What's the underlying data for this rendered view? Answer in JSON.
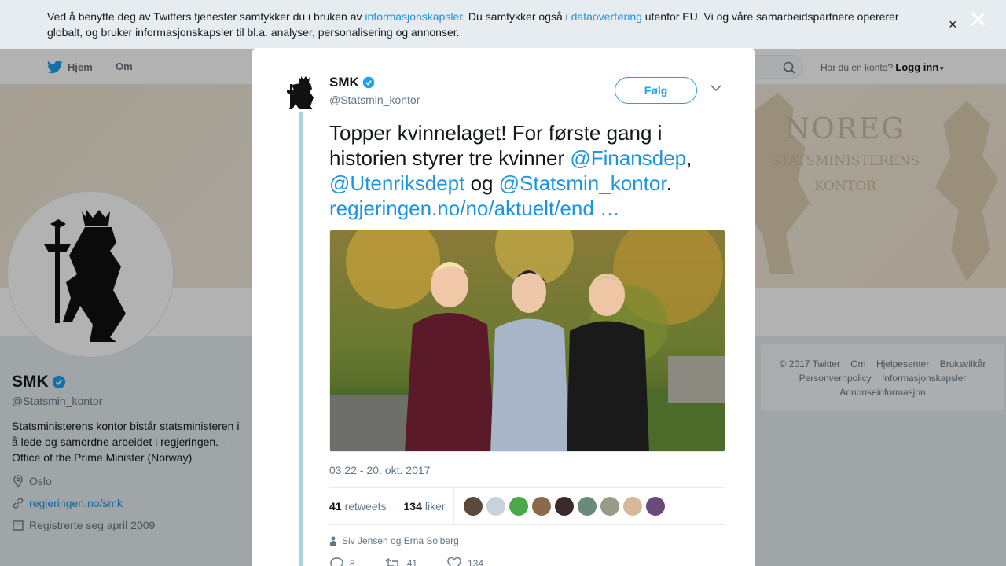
{
  "cookie_bar": {
    "text_1": "Ved å benytte deg av Twitters tjenester samtykker du i bruken av ",
    "link_1": "informasjonskapsler",
    "text_2": ". Du samtykker også i ",
    "link_2": "dataoverføring",
    "text_3": " utenfor EU. Vi og våre samarbeidspartnere opererer globalt, og bruker informasjonskapsler til bl.a. analyser, personalisering og annonser.",
    "close": "×"
  },
  "overlay_close": "✕",
  "nav": {
    "home": "Hjem",
    "about": "Om",
    "have_account": "Har du en konto?",
    "login": "Logg inn"
  },
  "banner": {
    "line1": "NOREG",
    "line2": "STATSMINISTERENS",
    "line3": "KONTOR"
  },
  "profile": {
    "name": "SMK",
    "handle": "@Statsmin_kontor",
    "bio": "Statsministerens kontor bistår statsministeren i å lede og samordne arbeidet i regjeringen. - Office of the Prime Minister (Norway)",
    "location": "Oslo",
    "url": "regjeringen.no/smk",
    "joined": "Registrerte seg april 2009"
  },
  "footer": {
    "items": [
      "© 2017 Twitter",
      "Om",
      "Hjelpesenter",
      "Bruksvilkår",
      "Personvernpolicy",
      "Informasjonskapsler",
      "Annonseinformasjon"
    ]
  },
  "tweet": {
    "name": "SMK",
    "handle": "@Statsmin_kontor",
    "follow": "Følg",
    "text_1": "Topper kvinnelaget! For første gang i historien styrer tre kvinner ",
    "mention_1": "@Finansdep",
    "text_2": ", ",
    "mention_2": "@Utenriksdept",
    "text_3": " og ",
    "mention_3": "@Statsmin_kontor",
    "text_4": ". ",
    "link": "regjeringen.no/no/aktuelt/end …",
    "timestamp": "03.22 - 20. okt. 2017",
    "retweets_count": "41",
    "retweets_label": "retweets",
    "likes_count": "134",
    "likes_label": "liker",
    "tagged": "Siv Jensen og Erna Solberg",
    "reply_count": "8",
    "retweet_action_count": "41",
    "like_action_count": "134"
  },
  "colors": {
    "link": "#1b95e0",
    "follow_accent": "#1da1f2",
    "verified": "#1da1f2",
    "thread_line": "#a9d3df"
  }
}
